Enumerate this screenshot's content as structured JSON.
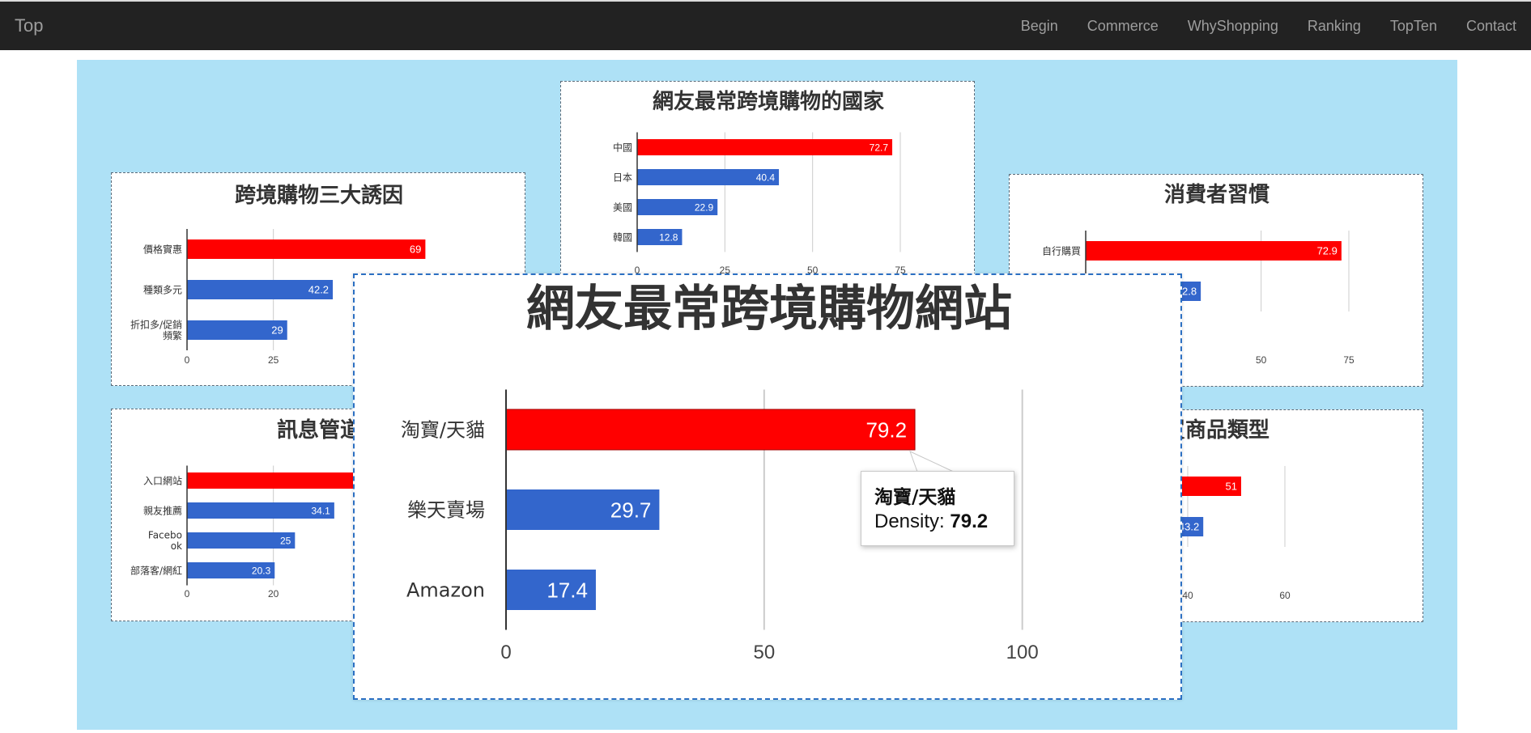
{
  "navbar": {
    "brand": "Top",
    "items": [
      "Begin",
      "Commerce",
      "WhyShopping",
      "Ranking",
      "TopTen",
      "Contact"
    ]
  },
  "colors": {
    "highlight": "#ff0000",
    "series": "#3366cc",
    "stage_bg": "#aee1f6",
    "navbar_bg": "#222222"
  },
  "chart_data": [
    {
      "id": "countries",
      "type": "bar",
      "title": "網友最常跨境購物的國家",
      "categories": [
        "中國",
        "日本",
        "美國",
        "韓國"
      ],
      "values": [
        72.7,
        40.4,
        22.9,
        12.8
      ],
      "highlight_index": 0,
      "xticks": [
        0,
        25,
        50,
        75
      ],
      "xlim": [
        0,
        90
      ],
      "grid": true
    },
    {
      "id": "reasons",
      "type": "bar",
      "title": "跨境購物三大誘因",
      "categories": [
        "價格實惠",
        "種類多元",
        "折扣多/促銷頻繁"
      ],
      "values": [
        69,
        42.2,
        29
      ],
      "highlight_index": 0,
      "xticks": [
        0,
        25
      ],
      "xlim": [
        0,
        75
      ],
      "grid": true
    },
    {
      "id": "habits",
      "type": "bar",
      "title": "消費者習慣",
      "categories": [
        "自行購買",
        ""
      ],
      "values": [
        72.9,
        32.8
      ],
      "visible_value_labels": [
        "72.9",
        "2.8"
      ],
      "highlight_index": 0,
      "xticks": [
        50,
        75
      ],
      "xlim": [
        0,
        90
      ],
      "grid": true
    },
    {
      "id": "channels",
      "type": "bar",
      "title": "訊息管道",
      "categories": [
        "入口網站",
        "親友推薦",
        "Facebook",
        "部落客/網紅"
      ],
      "values": [
        45,
        34.1,
        25,
        20.3
      ],
      "highlight_index": 0,
      "xticks": [
        0,
        20
      ],
      "xlim": [
        0,
        60
      ],
      "grid": true
    },
    {
      "id": "categories",
      "type": "bar",
      "title": "購買商品類型",
      "visible_title": "買商品類型",
      "categories": [
        "",
        ""
      ],
      "values": [
        51,
        43.2
      ],
      "highlight_index": 0,
      "xticks": [
        40,
        60
      ],
      "xlim": [
        0,
        70
      ],
      "grid": true
    },
    {
      "id": "websites",
      "type": "bar",
      "title": "網友最常跨境購物網站",
      "categories": [
        "淘寶/天貓",
        "樂天賣場",
        "Amazon"
      ],
      "values": [
        79.2,
        29.7,
        17.4
      ],
      "highlight_index": 0,
      "xticks": [
        0,
        50,
        100
      ],
      "xlim": [
        0,
        130
      ],
      "grid": true
    }
  ],
  "tooltip": {
    "title": "淘寶/天貓",
    "label": "Density:",
    "value": "79.2"
  }
}
